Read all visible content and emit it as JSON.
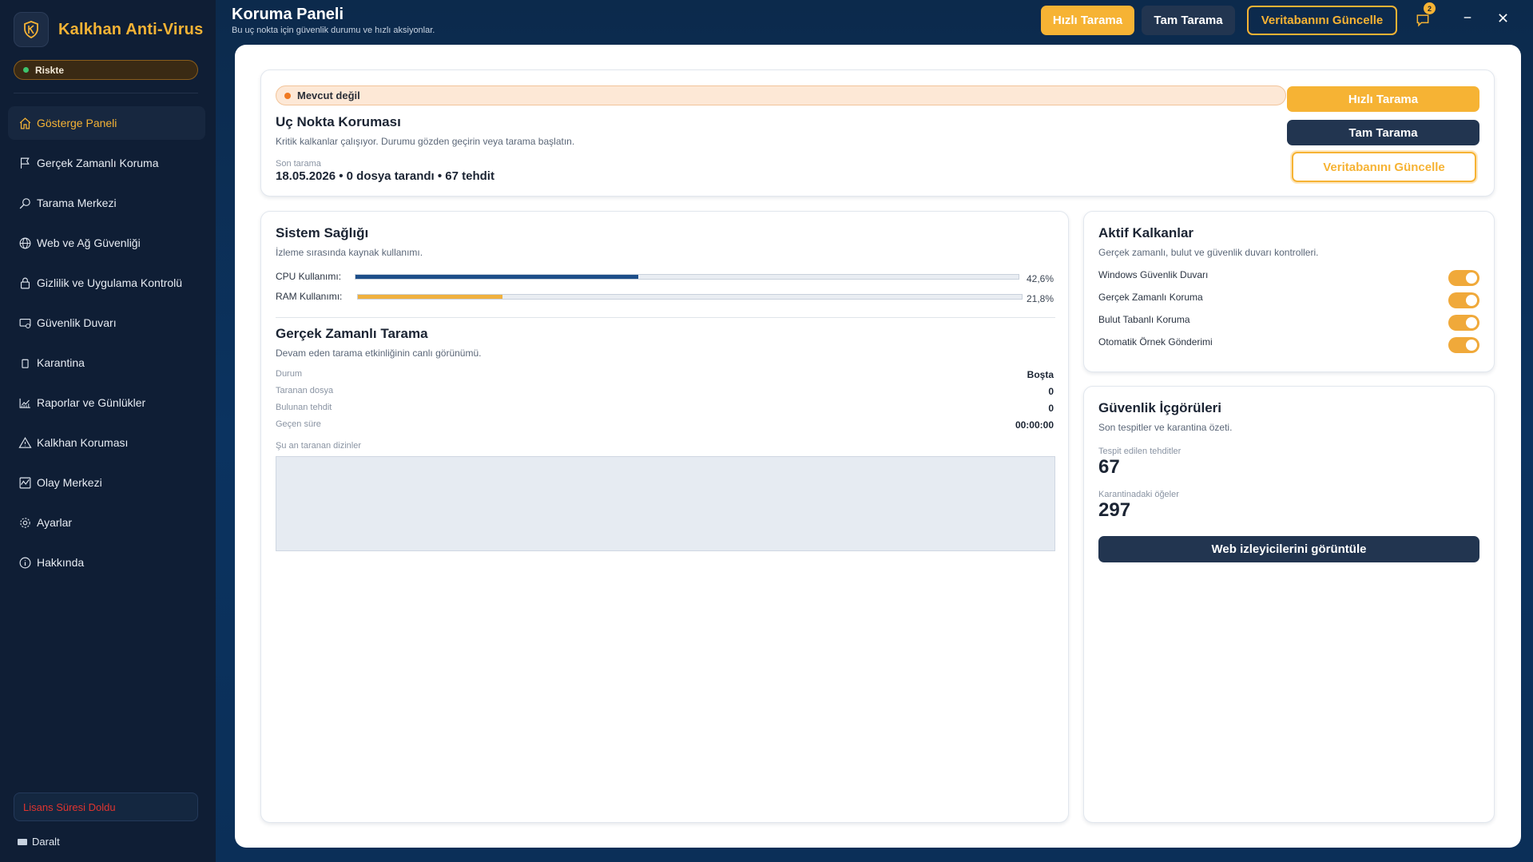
{
  "app": {
    "name": "Kalkhan Anti-Virus",
    "risk_status": "Riskte",
    "license_status": "Lisans Süresi Doldu",
    "collapse_label": "Daralt"
  },
  "sidebar": {
    "items": [
      {
        "label": "Gösterge Paneli",
        "icon": "home-icon",
        "active": true
      },
      {
        "label": "Gerçek Zamanlı Koruma",
        "icon": "flag-icon",
        "active": false
      },
      {
        "label": "Tarama Merkezi",
        "icon": "search-icon",
        "active": false
      },
      {
        "label": "Web ve Ağ Güvenliği",
        "icon": "globe-icon",
        "active": false
      },
      {
        "label": "Gizlilik ve Uygulama Kontrolü",
        "icon": "lock-icon",
        "active": false
      },
      {
        "label": "Güvenlik Duvarı",
        "icon": "firewall-icon",
        "active": false
      },
      {
        "label": "Karantina",
        "icon": "box-icon",
        "active": false
      },
      {
        "label": "Raporlar ve Günlükler",
        "icon": "chart-icon",
        "active": false
      },
      {
        "label": "Kalkhan Koruması",
        "icon": "warning-icon",
        "active": false
      },
      {
        "label": "Olay Merkezi",
        "icon": "activity-icon",
        "active": false
      },
      {
        "label": "Ayarlar",
        "icon": "gear-icon",
        "active": false
      },
      {
        "label": "Hakkında",
        "icon": "info-icon",
        "active": false
      }
    ]
  },
  "header": {
    "title": "Koruma Paneli",
    "subtitle": "Bu uç nokta için güvenlik durumu ve hızlı aksiyonlar.",
    "quick_scan": "Hızlı Tarama",
    "full_scan": "Tam Tarama",
    "update_db": "Veritabanını Güncelle",
    "notification_count": "2"
  },
  "endpoint": {
    "status": "Mevcut değil",
    "title": "Uç Nokta Koruması",
    "subtitle": "Kritik kalkanlar çalışıyor. Durumu gözden geçirin veya tarama başlatın.",
    "last_scan_label": "Son tarama",
    "last_scan_value": "18.05.2026 • 0 dosya tarandı • 67 tehdit",
    "quick_scan": "Hızlı Tarama",
    "full_scan": "Tam Tarama",
    "update_db": "Veritabanını Güncelle"
  },
  "system_health": {
    "title": "Sistem Sağlığı",
    "subtitle": "İzleme sırasında kaynak kullanımı.",
    "cpu_label": "CPU Kullanımı:",
    "cpu_value": "42,6%",
    "cpu_fraction": 0.426,
    "cpu_color": "#1d4e89",
    "ram_label": "RAM Kullanımı:",
    "ram_value": "21,8%",
    "ram_fraction": 0.218,
    "ram_color": "#f0b13e"
  },
  "realtime_scan": {
    "title": "Gerçek Zamanlı Tarama",
    "subtitle": "Devam eden tarama etkinliğinin canlı görünümü.",
    "rows": [
      {
        "label": "Durum",
        "value": "Boşta"
      },
      {
        "label": "Taranan dosya",
        "value": "0"
      },
      {
        "label": "Bulunan tehdit",
        "value": "0"
      },
      {
        "label": "Geçen süre",
        "value": "00:00:00"
      }
    ],
    "dirs_label": "Şu an taranan dizinler"
  },
  "active_shields": {
    "title": "Aktif Kalkanlar",
    "subtitle": "Gerçek zamanlı, bulut ve güvenlik duvarı kontrolleri.",
    "items": [
      {
        "label": "Windows Güvenlik Duvarı",
        "enabled": true
      },
      {
        "label": "Gerçek Zamanlı Koruma",
        "enabled": true
      },
      {
        "label": "Bulut Tabanlı Koruma",
        "enabled": true
      },
      {
        "label": "Otomatik Örnek Gönderimi",
        "enabled": true
      }
    ]
  },
  "insights": {
    "title": "Güvenlik İçgörüleri",
    "subtitle": "Son tespitler ve karantina özeti.",
    "threats_label": "Tespit edilen tehditler",
    "threats_value": "67",
    "quarantine_label": "Karantinadaki öğeler",
    "quarantine_value": "297",
    "button": "Web izleyicilerini görüntüle"
  },
  "colors": {
    "accent": "#f6b334",
    "navy": "#223550",
    "sidebar_bg": "#0f1e35"
  }
}
